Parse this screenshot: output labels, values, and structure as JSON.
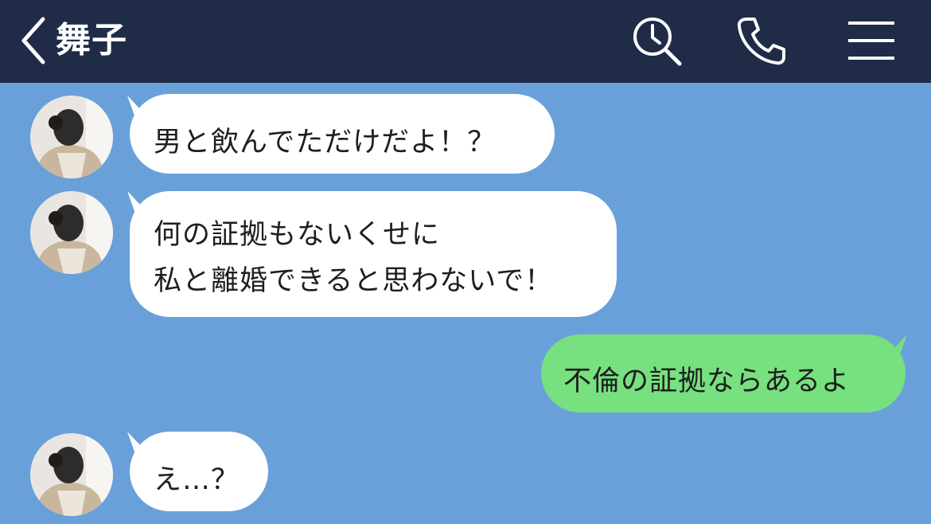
{
  "header": {
    "title": "舞子",
    "back_icon": "chevron-left-icon",
    "search_icon": "search-clock-icon",
    "call_icon": "phone-icon",
    "menu_icon": "hamburger-menu-icon",
    "colors": {
      "background": "#1f2b47",
      "icon": "#ffffff"
    }
  },
  "chat": {
    "background": "#6aa0da",
    "incoming_bubble_color": "#ffffff",
    "outgoing_bubble_color": "#77e07f",
    "messages": [
      {
        "side": "incoming",
        "lines": [
          "男と飲んでただけだよ！？"
        ]
      },
      {
        "side": "incoming",
        "lines": [
          "何の証拠もないくせに",
          "私と離婚できると思わないで！"
        ]
      },
      {
        "side": "outgoing",
        "lines": [
          "不倫の証拠ならあるよ"
        ]
      },
      {
        "side": "incoming",
        "lines": [
          "え…？"
        ]
      }
    ]
  }
}
